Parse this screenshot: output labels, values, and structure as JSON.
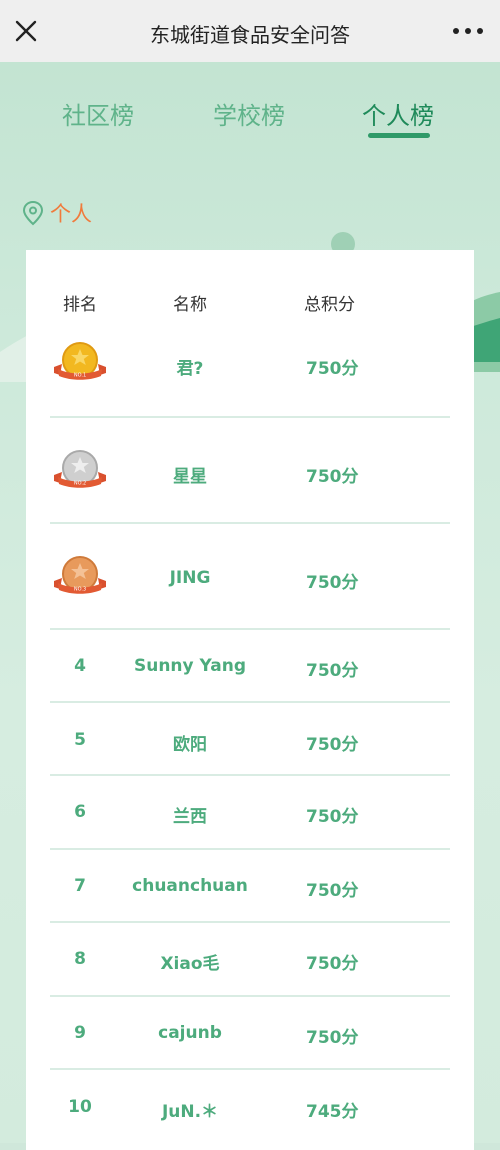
{
  "header": {
    "title": "东城街道食品安全问答"
  },
  "tabs": [
    {
      "label": "社区榜",
      "active": false
    },
    {
      "label": "学校榜",
      "active": false
    },
    {
      "label": "个人榜",
      "active": true
    }
  ],
  "section": {
    "label": "个人"
  },
  "table": {
    "columns": [
      "排名",
      "名称",
      "总积分"
    ],
    "rows": [
      {
        "rank": "1",
        "medal": "gold",
        "medal_text": "NO.1",
        "name": "君?",
        "score": "750分"
      },
      {
        "rank": "2",
        "medal": "silver",
        "medal_text": "NO.2",
        "name": "星星",
        "score": "750分"
      },
      {
        "rank": "3",
        "medal": "bronze",
        "medal_text": "NO.3",
        "name": "JING",
        "score": "750分"
      },
      {
        "rank": "4",
        "name": "Sunny Yang",
        "score": "750分"
      },
      {
        "rank": "5",
        "name": "欧阳",
        "score": "750分"
      },
      {
        "rank": "6",
        "name": "兰西",
        "score": "750分"
      },
      {
        "rank": "7",
        "name": "chuanchuan",
        "score": "750分"
      },
      {
        "rank": "8",
        "name": "Xiao毛",
        "score": "750分"
      },
      {
        "rank": "9",
        "name": "cajunb",
        "score": "750分"
      },
      {
        "rank": "10",
        "name": "JuN.＊",
        "score": "745分"
      }
    ]
  },
  "colors": {
    "accent": "#1f8a5a",
    "tab_inactive": "#5fb38a",
    "cell_text": "#4dab7d",
    "section_label": "#f07b3c",
    "gold": "#f2b820",
    "silver": "#c9c9c9",
    "bronze": "#e89a5c",
    "ribbon": "#d9502e"
  }
}
